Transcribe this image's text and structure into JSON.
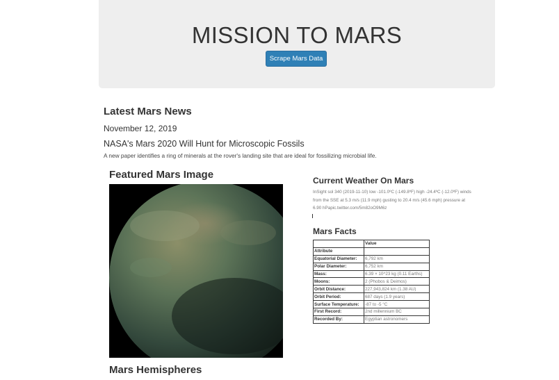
{
  "header": {
    "title": "MISSION TO MARS",
    "scrape_button_label": "Scrape Mars Data"
  },
  "news": {
    "heading": "Latest Mars News",
    "date": "November 12, 2019",
    "title": "NASA's Mars 2020 Will Hunt for Microscopic Fossils",
    "paragraph": "A new paper identifies a ring of minerals at the rover's landing site that are ideal for fossilizing microbial life."
  },
  "featured_image": {
    "heading": "Featured Mars Image"
  },
  "weather": {
    "heading": "Current Weather On Mars",
    "text": "InSight sol 340 (2019-11-10) low -101.0ºC (-149.8ºF) high -24.4ºC (-12.0ºF) winds from the SSE at 5.3 m/s (11.9 mph) gusting to 20.4 m/s (45.6 mph) pressure at 6.90 hPapic.twitter.com/5m82oO9M6z"
  },
  "facts": {
    "heading": "Mars Facts",
    "col_header_value": "Value",
    "index_label": "Attribute",
    "rows": [
      {
        "attr": "Equatorial Diameter:",
        "value": "6,792 km"
      },
      {
        "attr": "Polar Diameter:",
        "value": "6,752 km"
      },
      {
        "attr": "Mass:",
        "value": "6.39 × 10^23 kg (0.11 Earths)"
      },
      {
        "attr": "Moons:",
        "value": "2 (Phobos & Deimos)"
      },
      {
        "attr": "Orbit Distance:",
        "value": "227,943,824 km (1.38 AU)"
      },
      {
        "attr": "Orbit Period:",
        "value": "687 days (1.9 years)"
      },
      {
        "attr": "Surface Temperature:",
        "value": "-87 to -5 °C"
      },
      {
        "attr": "First Record:",
        "value": "2nd millennium BC"
      },
      {
        "attr": "Recorded By:",
        "value": "Egyptian astronomers"
      }
    ]
  },
  "hemispheres": {
    "heading": "Mars Hemispheres"
  }
}
